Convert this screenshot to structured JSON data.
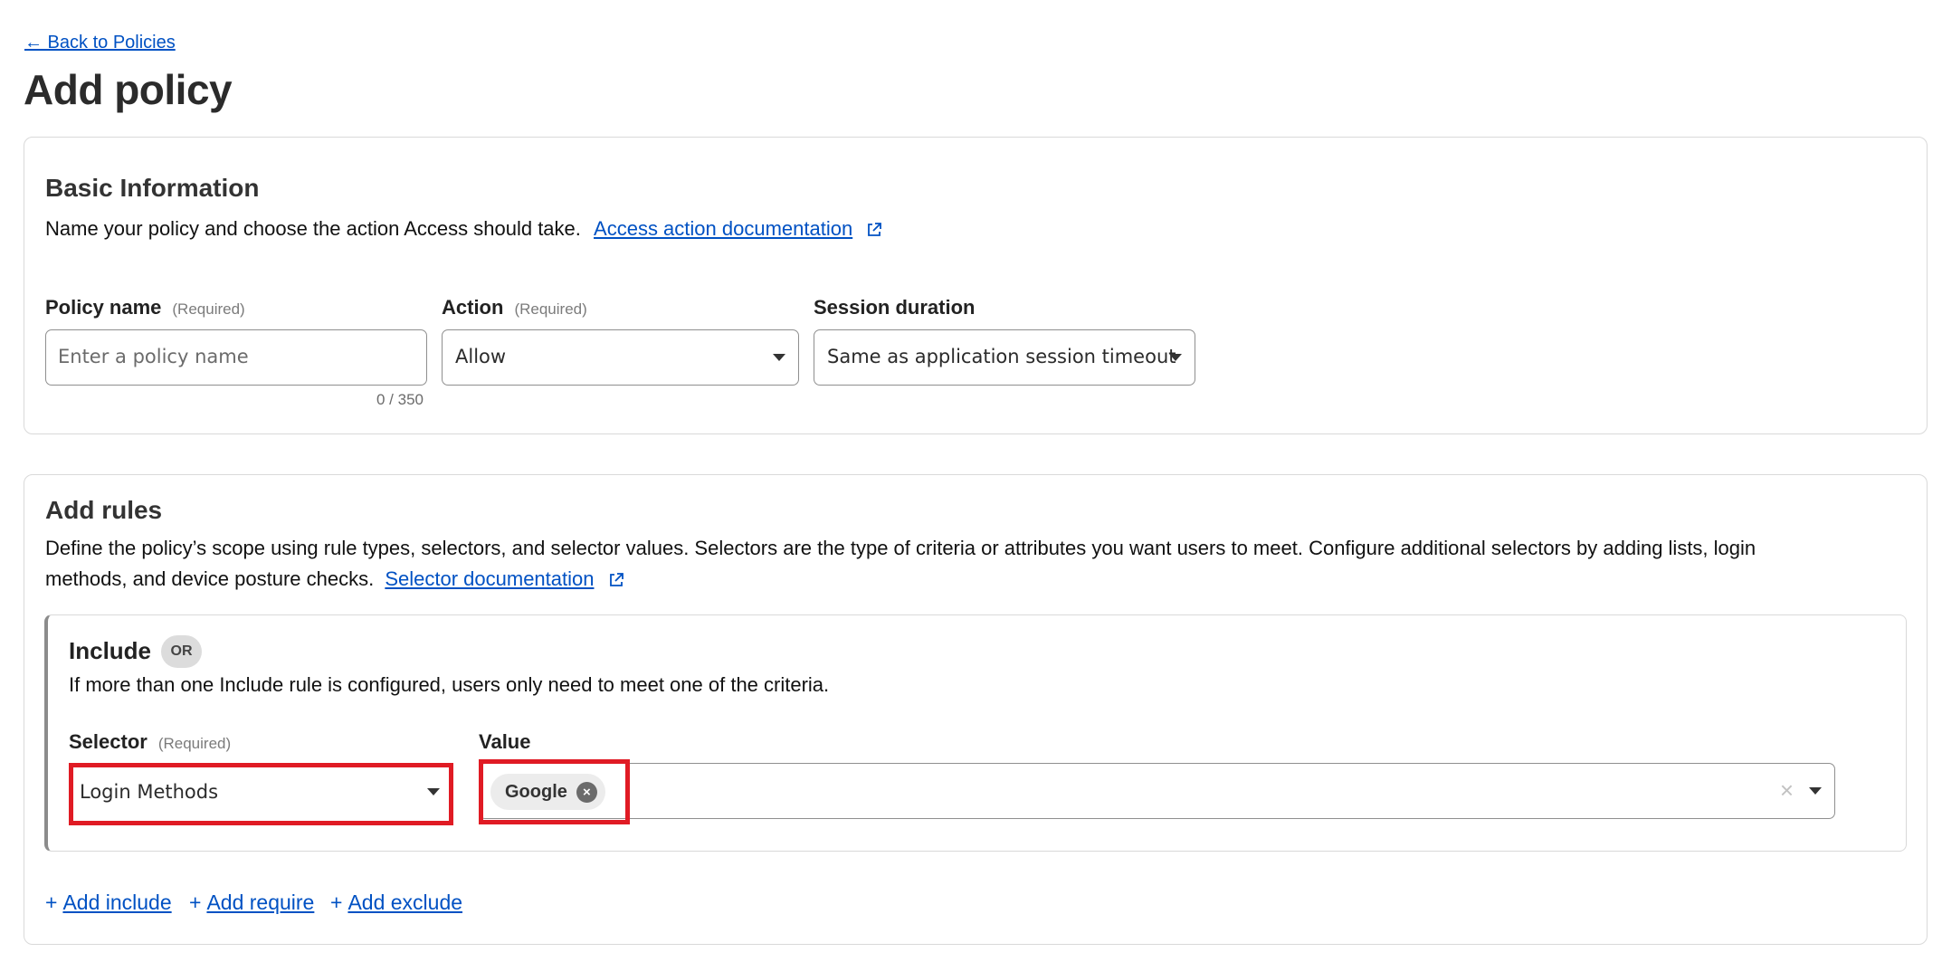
{
  "nav": {
    "back_link": "← Back to Policies"
  },
  "page": {
    "title": "Add policy"
  },
  "basic": {
    "title": "Basic Information",
    "description": "Name your policy and choose the action Access should take.",
    "doc_link": "Access action documentation",
    "policy_name": {
      "label": "Policy name",
      "required": "(Required)",
      "placeholder": "Enter a policy name",
      "counter": "0 / 350"
    },
    "action": {
      "label": "Action",
      "required": "(Required)",
      "value": "Allow"
    },
    "session": {
      "label": "Session duration",
      "value": "Same as application session timeout"
    }
  },
  "rules": {
    "title": "Add rules",
    "description_line1": "Define the policy’s scope using rule types, selectors, and selector values. Selectors are the type of criteria or attributes you want users to meet. Configure additional selectors by adding lists, login",
    "description_line2": "methods, and device posture checks.",
    "doc_link": "Selector documentation",
    "include": {
      "title": "Include",
      "badge": "OR",
      "description": "If more than one Include rule is configured, users only need to meet one of the criteria.",
      "selector": {
        "label": "Selector",
        "required": "(Required)",
        "value": "Login Methods"
      },
      "value": {
        "label": "Value",
        "chip": "Google",
        "chip_remove": "×",
        "clear": "×"
      }
    },
    "actions": {
      "add_include": "Add include",
      "add_require": "Add require",
      "add_exclude": "Add exclude",
      "plus": "+"
    }
  },
  "colors": {
    "link": "#0051c3",
    "highlight": "#e01b24"
  },
  "icons": {
    "external_link": "external-link-icon",
    "caret": "caret-down-icon"
  }
}
